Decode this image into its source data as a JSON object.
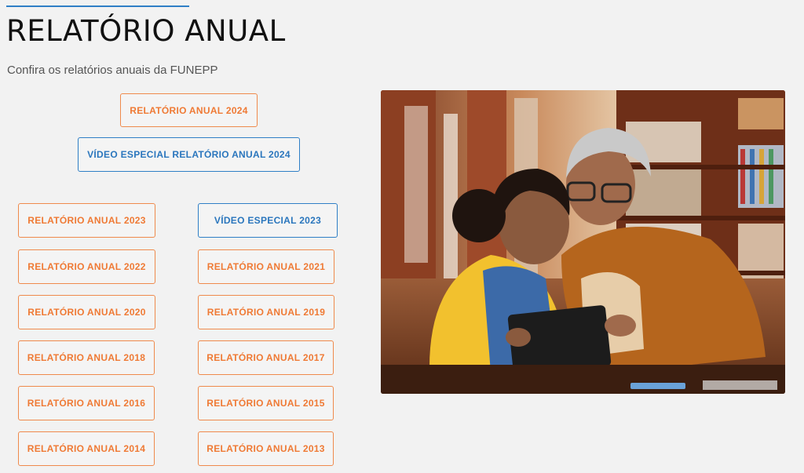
{
  "header": {
    "title": "RELATÓRIO ANUAL",
    "subtitle": "Confira os relatórios anuais da FUNEPP"
  },
  "featured": {
    "report_2024": "RELATÓRIO ANUAL 2024",
    "video_2024": "VÍDEO ESPECIAL RELATÓRIO ANUAL 2024"
  },
  "grid": {
    "report_2023": "RELATÓRIO ANUAL 2023",
    "video_2023": "VÍDEO ESPECIAL 2023",
    "report_2022": "RELATÓRIO ANUAL 2022",
    "report_2021": "RELATÓRIO ANUAL 2021",
    "report_2020": "RELATÓRIO ANUAL 2020",
    "report_2019": "RELATÓRIO ANUAL 2019",
    "report_2018": "RELATÓRIO ANUAL 2018",
    "report_2017": "RELATÓRIO ANUAL 2017",
    "report_2016": "RELATÓRIO ANUAL 2016",
    "report_2015": "RELATÓRIO ANUAL 2015",
    "report_2014": "RELATÓRIO ANUAL 2014",
    "report_2013": "RELATÓRIO ANUAL 2013"
  },
  "colors": {
    "accent_orange": "#ef7a35",
    "accent_blue": "#2f7fc6",
    "background": "#f2f2f2"
  }
}
